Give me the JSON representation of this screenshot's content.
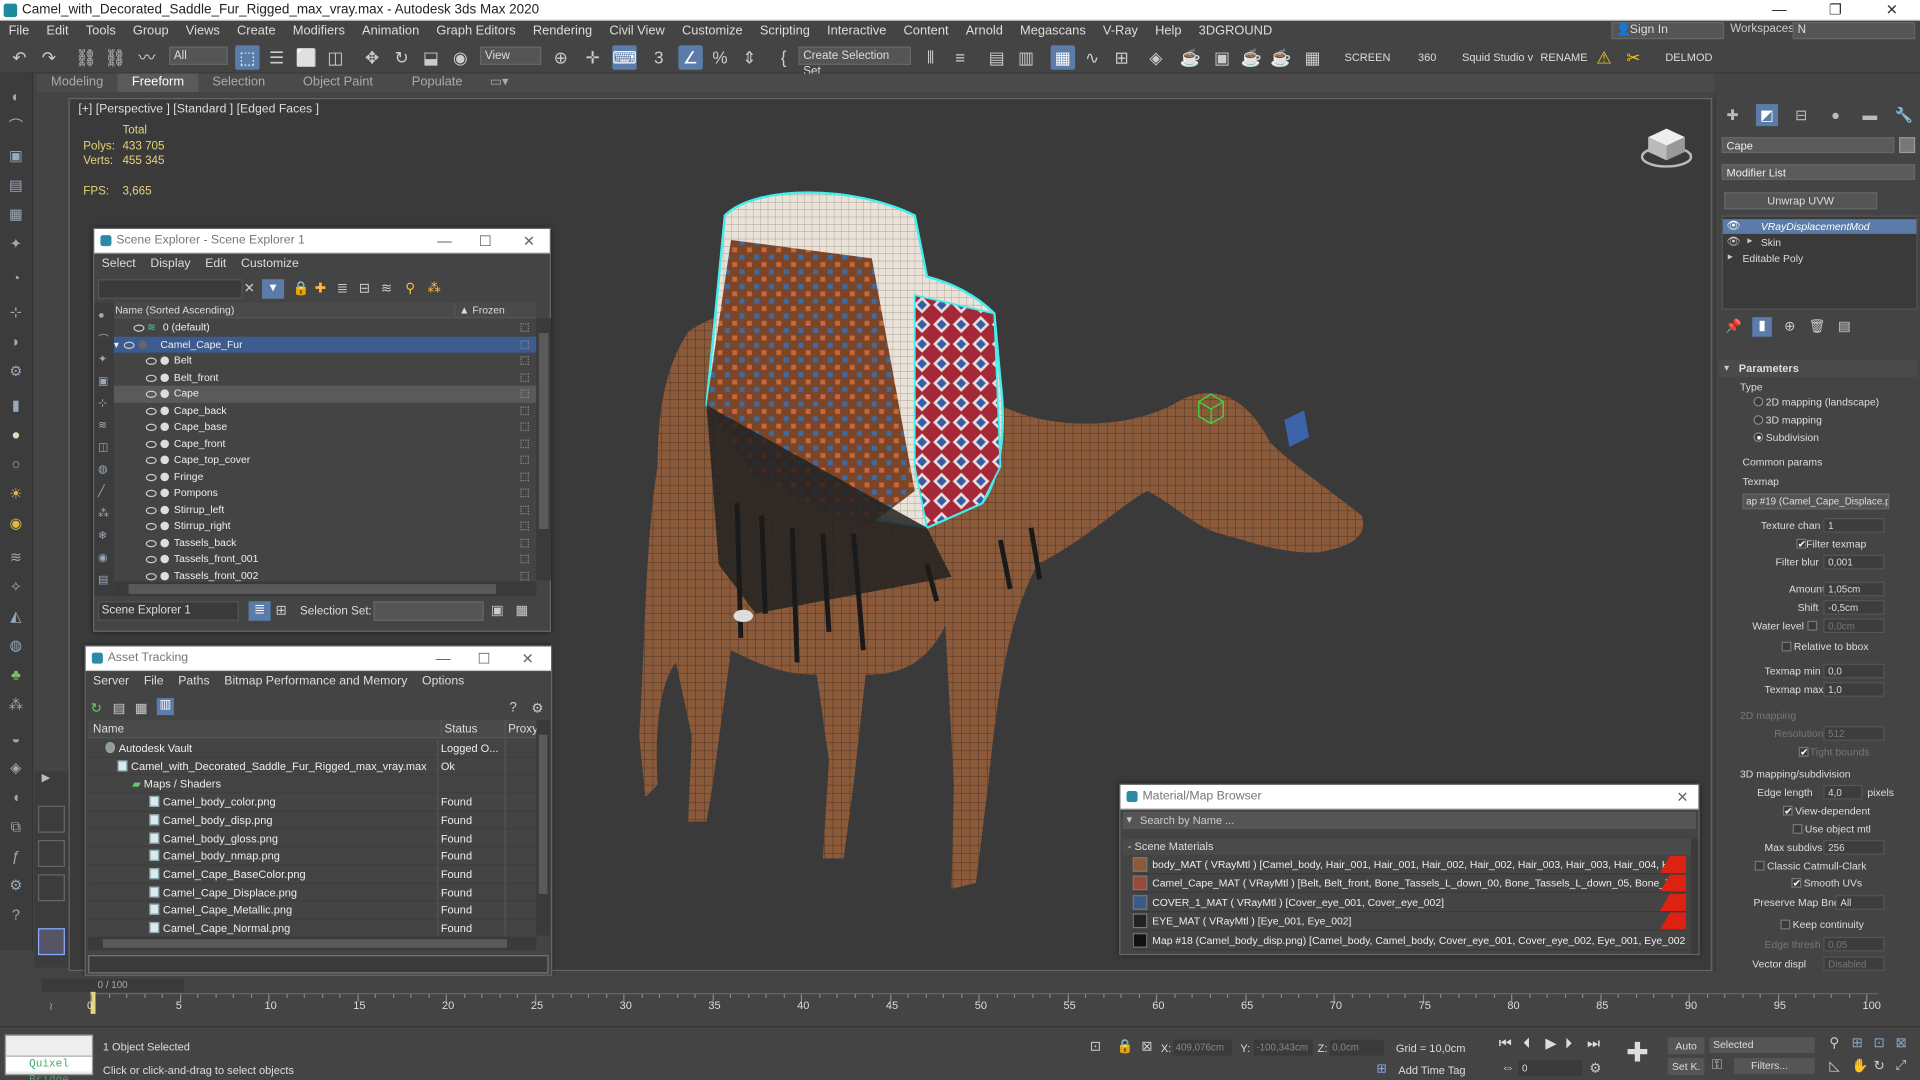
{
  "window": {
    "title": "Camel_with_Decorated_Saddle_Fur_Rigged_max_vray.max - Autodesk 3ds Max 2020"
  },
  "menu": [
    "File",
    "Edit",
    "Tools",
    "Group",
    "Views",
    "Create",
    "Modifiers",
    "Animation",
    "Graph Editors",
    "Rendering",
    "Civil View",
    "Customize",
    "Scripting",
    "Interactive",
    "Content",
    "Arnold",
    "Megascans",
    "V-Ray",
    "Help",
    "3DGROUND"
  ],
  "account": {
    "signin": "Sign In",
    "workspaces_label": "Workspaces:",
    "workspace_value": "N"
  },
  "toolbar": {
    "filter": "All",
    "view": "View",
    "create_selection_set": "Create Selection Set",
    "screen": "SCREEN",
    "value_360": "360",
    "squid": "Squid Studio v",
    "rename": "RENAME",
    "delmod": "DELMOD"
  },
  "ribbon_tabs": [
    "Modeling",
    "Freeform",
    "Selection",
    "Object Paint",
    "Populate"
  ],
  "viewport": {
    "label": "[+] [Perspective ] [Standard ] [Edged Faces ]",
    "total": "Total",
    "polys_label": "Polys:",
    "polys": "433 705",
    "verts_label": "Verts:",
    "verts": "455 345",
    "fps_label": "FPS:",
    "fps": "3,665"
  },
  "scene_explorer": {
    "title": "Scene Explorer - Scene Explorer 1",
    "menu": [
      "Select",
      "Display",
      "Edit",
      "Customize"
    ],
    "col_name": "Name (Sorted Ascending)",
    "col_frozen": "▲ Frozen",
    "rows": [
      {
        "label": "0 (default)",
        "level": 0
      },
      {
        "label": "Camel_Cape_Fur",
        "level": 1
      },
      {
        "label": "Belt",
        "level": 2
      },
      {
        "label": "Belt_front",
        "level": 2
      },
      {
        "label": "Cape",
        "level": 2
      },
      {
        "label": "Cape_back",
        "level": 2
      },
      {
        "label": "Cape_base",
        "level": 2
      },
      {
        "label": "Cape_front",
        "level": 2
      },
      {
        "label": "Cape_top_cover",
        "level": 2
      },
      {
        "label": "Fringe",
        "level": 2
      },
      {
        "label": "Pompons",
        "level": 2
      },
      {
        "label": "Stirrup_left",
        "level": 2
      },
      {
        "label": "Stirrup_right",
        "level": 2
      },
      {
        "label": "Tassels_back",
        "level": 2
      },
      {
        "label": "Tassels_front_001",
        "level": 2
      },
      {
        "label": "Tassels_front_002",
        "level": 2
      }
    ],
    "footer_name": "Scene Explorer 1",
    "selection_set_label": "Selection Set:"
  },
  "asset_tracking": {
    "title": "Asset Tracking",
    "menu": [
      "Server",
      "File",
      "Paths",
      "Bitmap Performance and Memory",
      "Options"
    ],
    "columns": [
      "Name",
      "Status",
      "Proxy"
    ],
    "rows": [
      {
        "name": "Autodesk Vault",
        "status": "Logged O...",
        "kind": "vault"
      },
      {
        "name": "Camel_with_Decorated_Saddle_Fur_Rigged_max_vray.max",
        "status": "Ok",
        "kind": "max"
      },
      {
        "name": "Maps / Shaders",
        "status": "",
        "kind": "folder"
      },
      {
        "name": "Camel_body_color.png",
        "status": "Found",
        "kind": "file"
      },
      {
        "name": "Camel_body_disp.png",
        "status": "Found",
        "kind": "file"
      },
      {
        "name": "Camel_body_gloss.png",
        "status": "Found",
        "kind": "file"
      },
      {
        "name": "Camel_body_nmap.png",
        "status": "Found",
        "kind": "file"
      },
      {
        "name": "Camel_Cape_BaseColor.png",
        "status": "Found",
        "kind": "file"
      },
      {
        "name": "Camel_Cape_Displace.png",
        "status": "Found",
        "kind": "file"
      },
      {
        "name": "Camel_Cape_Metallic.png",
        "status": "Found",
        "kind": "file"
      },
      {
        "name": "Camel_Cape_Normal.png",
        "status": "Found",
        "kind": "file"
      }
    ]
  },
  "material_browser": {
    "title": "Material/Map Browser",
    "search_placeholder": "Search by Name ...",
    "group": "- Scene Materials",
    "rows": [
      {
        "text": "body_MAT  ( VRayMtl )  [Camel_body, Hair_001, Hair_001, Hair_002, Hair_002, Hair_003, Hair_003, Hair_004, Hair_...",
        "swatch": "#8a5a3a"
      },
      {
        "text": "Camel_Cape_MAT  ( VRayMtl )  [Belt, Belt_front, Bone_Tassels_L_down_00, Bone_Tassels_L_down_05, Bone_Tassel...",
        "swatch": "#9a4a3a"
      },
      {
        "text": "COVER_1_MAT  ( VRayMtl )  [Cover_eye_001, Cover_eye_002]",
        "swatch": "#3a5a8a"
      },
      {
        "text": "EYE_MAT  ( VRayMtl )  [Eye_001, Eye_002]",
        "swatch": "#222222"
      },
      {
        "text": "Map #18 (Camel_body_disp.png)  [Camel_body, Camel_body, Cover_eye_001, Cover_eye_002, Eye_001, Eye_002,...",
        "swatch": "#111111"
      }
    ]
  },
  "command_panel": {
    "object_name": "Cape",
    "modifier_list": "Modifier List",
    "unwrap_btn": "Unwrap UVW",
    "stack": [
      "VRayDisplacementMod",
      "Skin",
      "Editable Poly"
    ],
    "rollout_title": "Parameters",
    "type_label": "Type",
    "type_options": [
      "2D mapping (landscape)",
      "3D mapping",
      "Subdivision"
    ],
    "common_params": "Common params",
    "texmap_label": "Texmap",
    "texmap_value": "ap #19 (Camel_Cape_Displace.pn",
    "texture_chan_label": "Texture chan",
    "texture_chan": "1",
    "filter_texmap": "Filter texmap",
    "filter_blur_label": "Filter blur",
    "filter_blur": "0,001",
    "amount_label": "Amount",
    "amount": "1,05cm",
    "shift_label": "Shift",
    "shift": "-0,5cm",
    "water_label": "Water level",
    "water": "0,0cm",
    "relative_bbox": "Relative to bbox",
    "texmap_min_label": "Texmap min",
    "texmap_min": "0,0",
    "texmap_max_label": "Texmap max",
    "texmap_max": "1,0",
    "mapping2d": "2D mapping",
    "resolution_label": "Resolution",
    "resolution": "512",
    "tight_bounds": "Tight bounds",
    "mapping3d": "3D mapping/subdivision",
    "edge_length_label": "Edge length",
    "edge_length": "4,0",
    "pixels": "pixels",
    "view_dependent": "View-dependent",
    "use_object_mtl": "Use object mtl",
    "max_subdivs_label": "Max subdivs",
    "max_subdivs": "256",
    "classic_catmull": "Classic Catmull-Clark",
    "smooth_uvs": "Smooth UVs",
    "preserve_map_label": "Preserve Map Bnd",
    "preserve_map": "All",
    "keep_continuity": "Keep continuity",
    "edge_thresh_label": "Edge thresh",
    "edge_thresh": "0,05",
    "vector_displ_label": "Vector displ",
    "vector_displ": "Disabled"
  },
  "timeline": {
    "frame": "0 / 100",
    "ticks": [
      "0",
      "5",
      "10",
      "15",
      "20",
      "25",
      "30",
      "35",
      "40",
      "45",
      "50",
      "55",
      "60",
      "65",
      "70",
      "75",
      "80",
      "85",
      "90",
      "95",
      "100"
    ]
  },
  "status": {
    "selected": "1 Object Selected",
    "hint": "Click or click-and-drag to select objects",
    "quixel": "Quixel Bridge",
    "x_label": "X:",
    "x": "409,076cm",
    "y_label": "Y:",
    "y": "-100,343cm",
    "z_label": "Z:",
    "z": "0,0cm",
    "grid": "Grid = 10,0cm",
    "add_time_tag": "Add Time Tag",
    "auto": "Auto",
    "set_key": "Set K.",
    "key_filter": "Selected",
    "filters": "Filters...",
    "frame_field": "0"
  }
}
